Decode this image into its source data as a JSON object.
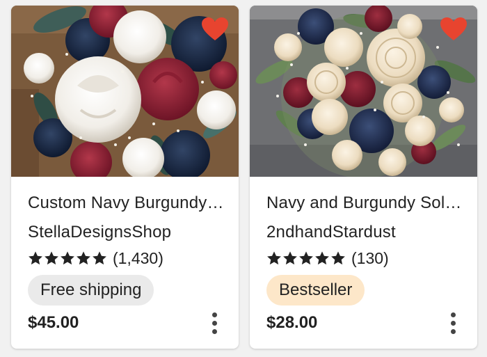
{
  "colors": {
    "favorite": "#e8442f",
    "free_shipping_bg": "#eaeaea",
    "bestseller_bg": "#fde7c9",
    "text": "#222222"
  },
  "listings": [
    {
      "title": "Custom Navy Burgundy Sola Wood Flower Bouquet",
      "shop": "StellaDesignsShop",
      "rating_count": "(1,430)",
      "badge": "Free shipping",
      "price": "$45.00",
      "rating_stars": 5
    },
    {
      "title": "Navy and Burgundy Sola Wood Bridal Bouquet",
      "shop": "2ndhandStardust",
      "rating_count": "(130)",
      "badge": "Bestseller",
      "price": "$28.00",
      "rating_stars": 5
    }
  ]
}
